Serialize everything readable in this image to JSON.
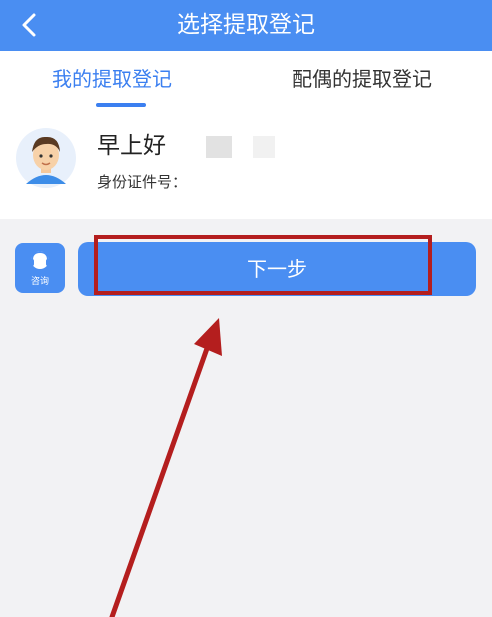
{
  "header": {
    "title": "选择提取登记"
  },
  "tabs": [
    {
      "label": "我的提取登记"
    },
    {
      "label": "配偶的提取登记"
    }
  ],
  "user": {
    "greeting": "早上好",
    "id_label": "身份证件号："
  },
  "consult": {
    "label": "咨询"
  },
  "next_button": {
    "label": "下一步"
  },
  "colors": {
    "primary": "#4a8ef2",
    "tab_active": "#3b7ff0",
    "highlight": "#b41e1e",
    "background": "#f2f2f4"
  }
}
